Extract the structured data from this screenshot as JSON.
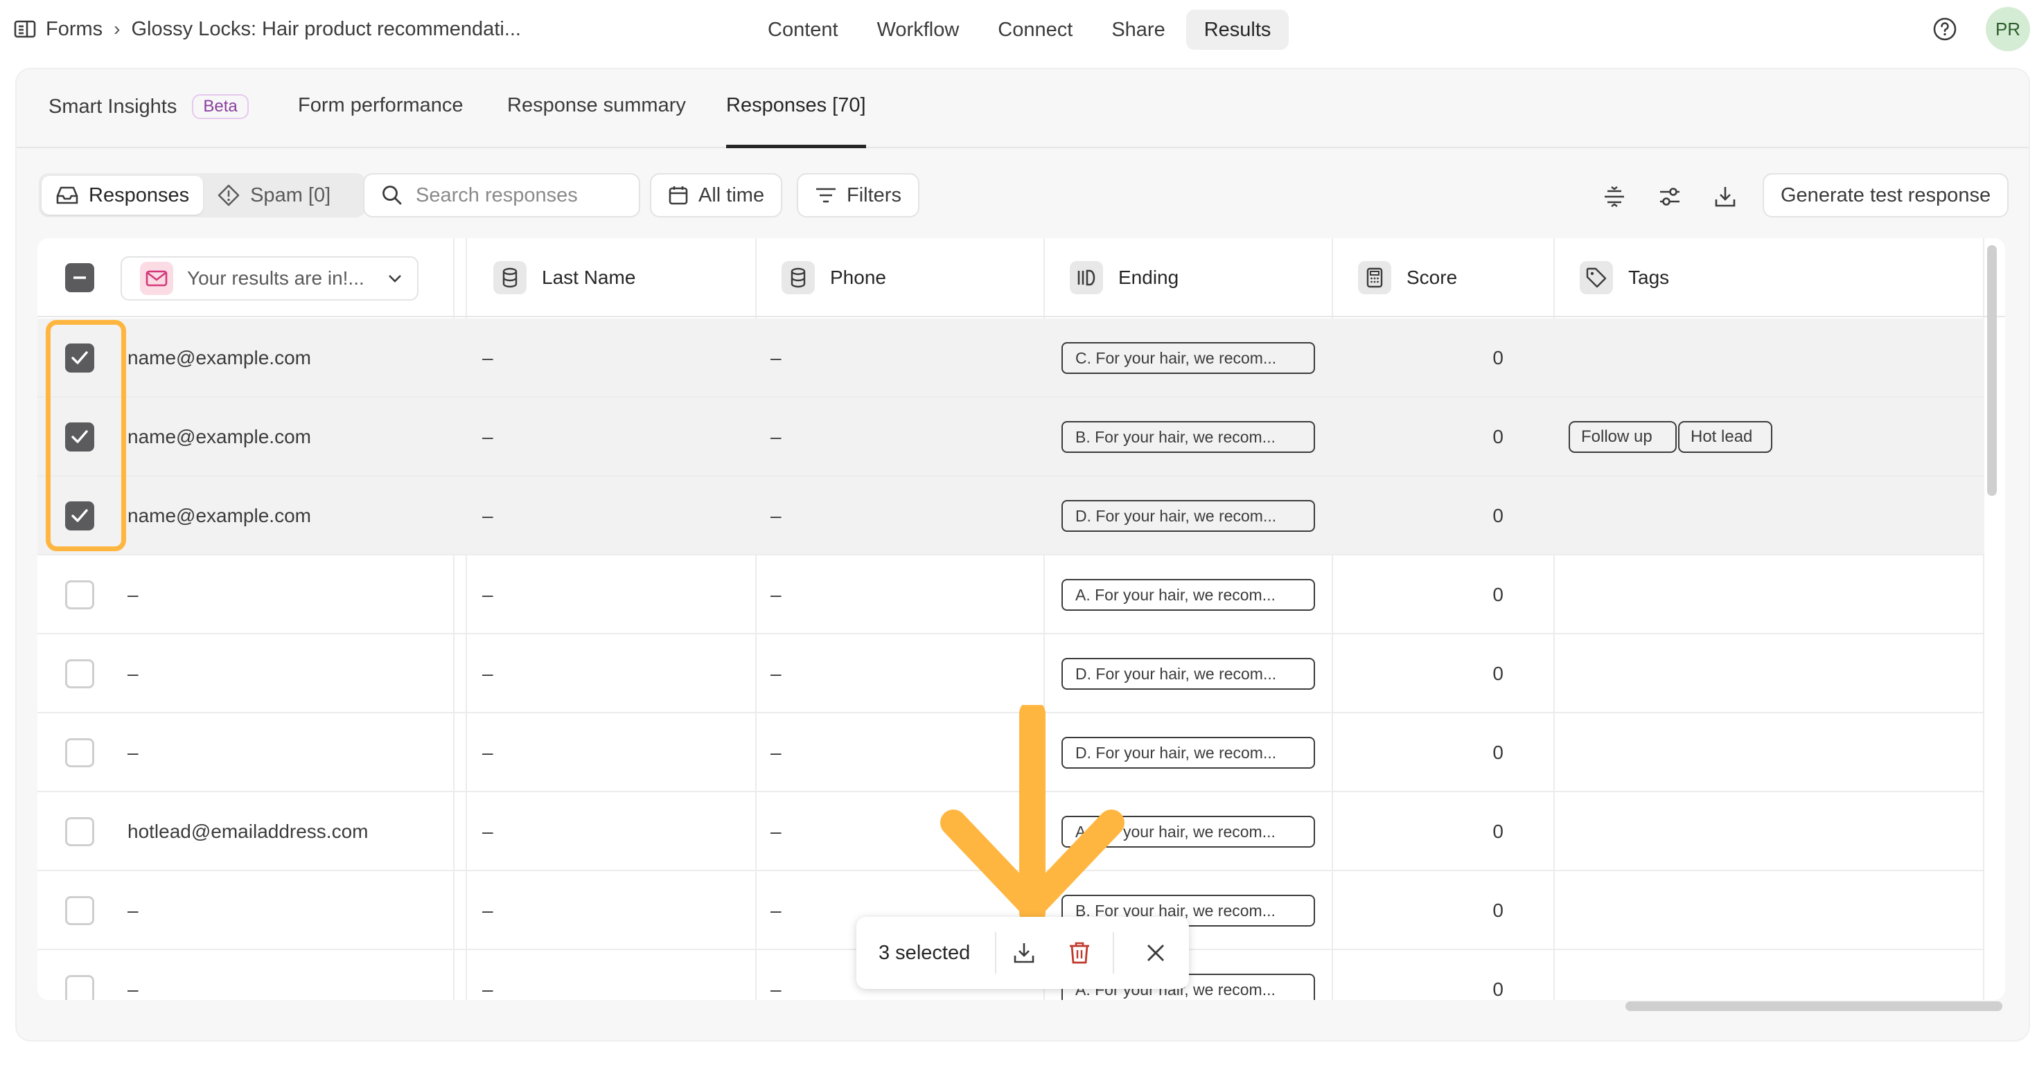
{
  "breadcrumb": {
    "root": "Forms",
    "form_title": "Glossy Locks: Hair product recommendati..."
  },
  "top_nav": [
    {
      "label": "Content"
    },
    {
      "label": "Workflow"
    },
    {
      "label": "Connect"
    },
    {
      "label": "Share"
    },
    {
      "label": "Results",
      "active": true
    }
  ],
  "user": {
    "initials": "PR"
  },
  "sub_tabs": {
    "smart_insights": "Smart Insights",
    "beta": "Beta",
    "form_performance": "Form performance",
    "response_summary": "Response summary",
    "responses": "Responses [70]"
  },
  "toolbar": {
    "responses": "Responses",
    "spam": "Spam [0]",
    "search_placeholder": "Search responses",
    "time_filter": "All time",
    "filters": "Filters",
    "generate": "Generate test response"
  },
  "columns": {
    "first": "Your results are in!...",
    "last_name": "Last Name",
    "phone": "Phone",
    "ending": "Ending",
    "score": "Score",
    "tags": "Tags"
  },
  "rows": [
    {
      "email": "name@example.com",
      "last_name": "–",
      "phone": "–",
      "ending": "C. For your hair, we recom...",
      "score": "0",
      "tags": [],
      "selected": true
    },
    {
      "email": "name@example.com",
      "last_name": "–",
      "phone": "–",
      "ending": "B. For your hair, we recom...",
      "score": "0",
      "tags": [
        "Follow up",
        "Hot lead"
      ],
      "selected": true
    },
    {
      "email": "name@example.com",
      "last_name": "–",
      "phone": "–",
      "ending": "D. For your hair, we recom...",
      "score": "0",
      "tags": [],
      "selected": true
    },
    {
      "email": "–",
      "last_name": "–",
      "phone": "–",
      "ending": "A. For your hair, we recom...",
      "score": "0",
      "tags": [],
      "selected": false
    },
    {
      "email": "–",
      "last_name": "–",
      "phone": "–",
      "ending": "D. For your hair, we recom...",
      "score": "0",
      "tags": [],
      "selected": false
    },
    {
      "email": "–",
      "last_name": "–",
      "phone": "–",
      "ending": "D. For your hair, we recom...",
      "score": "0",
      "tags": [],
      "selected": false
    },
    {
      "email": "hotlead@emailaddress.com",
      "last_name": "–",
      "phone": "–",
      "ending": "A. For your hair, we recom...",
      "score": "0",
      "tags": [],
      "selected": false
    },
    {
      "email": "–",
      "last_name": "–",
      "phone": "–",
      "ending": "B. For your hair, we recom...",
      "score": "0",
      "tags": [],
      "selected": false
    },
    {
      "email": "–",
      "last_name": "–",
      "phone": "–",
      "ending": "A. For your hair, we recom...",
      "score": "0",
      "tags": [],
      "selected": false
    }
  ],
  "selection_bar": {
    "count_label": "3 selected"
  },
  "colors": {
    "highlight": "#ffb640",
    "delete": "#c0392b",
    "selected_row": "#f2f2f2"
  }
}
